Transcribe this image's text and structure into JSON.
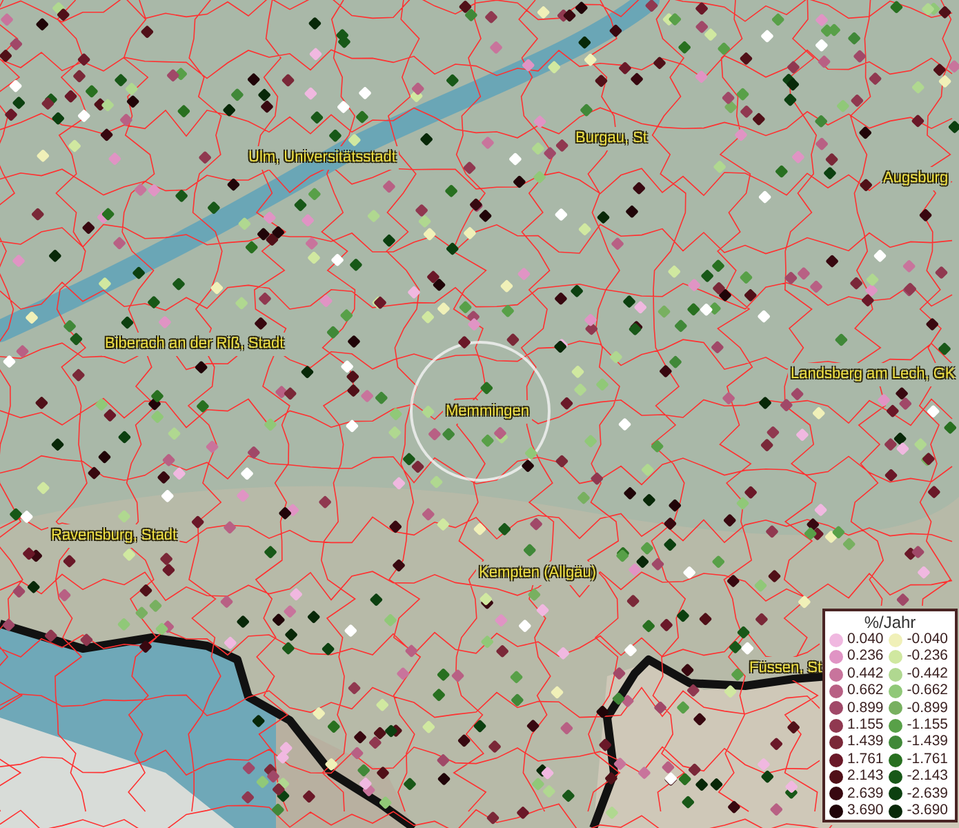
{
  "map": {
    "place_labels": [
      {
        "text": "Ulm, Universitätsstadt"
      },
      {
        "text": "Burgau, St"
      },
      {
        "text": "Augsburg"
      },
      {
        "text": "Biberach an der Riß, Stadt"
      },
      {
        "text": "Landsberg am Lech, GK"
      },
      {
        "text": "Memmingen"
      },
      {
        "text": "Ravensburg, Stadt"
      },
      {
        "text": "Kempten (Allgäu)"
      },
      {
        "text": "Füssen, St"
      }
    ]
  },
  "legend": {
    "title": "%/Jahr",
    "rows": [
      {
        "increase": {
          "value": "0.040",
          "color": "#f0b8e0"
        },
        "decrease": {
          "value": "-0.040",
          "color": "#f0f0b8"
        }
      },
      {
        "increase": {
          "value": "0.236",
          "color": "#e094c4"
        },
        "decrease": {
          "value": "-0.236",
          "color": "#d0e8a0"
        }
      },
      {
        "increase": {
          "value": "0.442",
          "color": "#c8749c"
        },
        "decrease": {
          "value": "-0.442",
          "color": "#b0d890"
        }
      },
      {
        "increase": {
          "value": "0.662",
          "color": "#b86084"
        },
        "decrease": {
          "value": "-0.662",
          "color": "#90c878"
        }
      },
      {
        "increase": {
          "value": "0.899",
          "color": "#a04868"
        },
        "decrease": {
          "value": "-0.899",
          "color": "#78b060"
        }
      },
      {
        "increase": {
          "value": "1.155",
          "color": "#903850"
        },
        "decrease": {
          "value": "-1.155",
          "color": "#58a048"
        }
      },
      {
        "increase": {
          "value": "1.439",
          "color": "#7a2838"
        },
        "decrease": {
          "value": "-1.439",
          "color": "#408838"
        }
      },
      {
        "increase": {
          "value": "1.761",
          "color": "#6a1828"
        },
        "decrease": {
          "value": "-1.761",
          "color": "#287020"
        }
      },
      {
        "increase": {
          "value": "2.143",
          "color": "#501018"
        },
        "decrease": {
          "value": "-2.143",
          "color": "#185818"
        }
      },
      {
        "increase": {
          "value": "2.639",
          "color": "#380810"
        },
        "decrease": {
          "value": "-2.639",
          "color": "#0c4010"
        }
      },
      {
        "increase": {
          "value": "3.690",
          "color": "#200408"
        },
        "decrease": {
          "value": "-3.690",
          "color": "#082808"
        }
      }
    ]
  }
}
